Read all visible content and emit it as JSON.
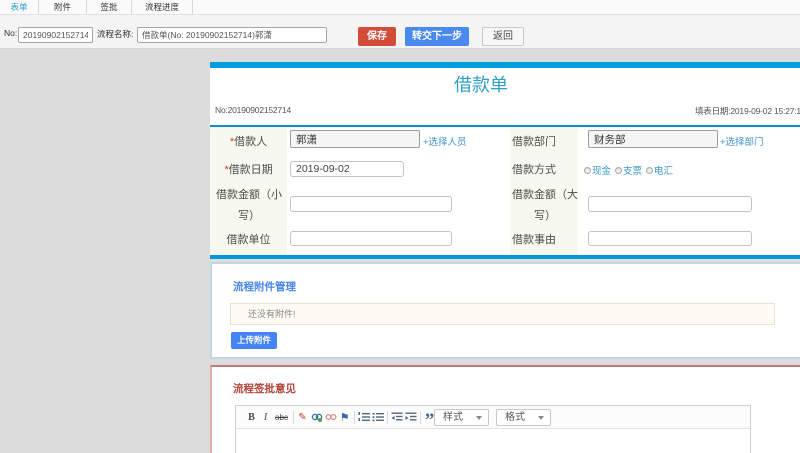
{
  "tabs": [
    {
      "label": "表单",
      "active": true
    },
    {
      "label": "附件",
      "active": false
    },
    {
      "label": "签批",
      "active": false
    },
    {
      "label": "流程进度",
      "active": false
    }
  ],
  "toolbar": {
    "no_label": "No:",
    "no_value": "20190902152714",
    "name_label": "流程名称:",
    "name_value": "借款单(No: 20190902152714)郭潇",
    "save_label": "保存",
    "next_label": "转交下一步",
    "back_label": "返回"
  },
  "form": {
    "title": "借款单",
    "no_text": "No:20190902152714",
    "date_text": "填表日期:2019-09-02 15:27:1",
    "required_mark": "*",
    "borrower_label": "借款人",
    "borrower_value": "郭潇",
    "borrower_link": "+选择人员",
    "dept_label": "借款部门",
    "dept_value": "财务部",
    "dept_link": "+选择部门",
    "date_label": "借款日期",
    "date_value": "2019-09-02",
    "method_label": "借款方式",
    "methods": [
      "现金",
      "支票",
      "电汇"
    ],
    "amount_small_label": "借款金额（小写）",
    "amount_big_label": "借款金额（大写）",
    "unit_label": "借款单位",
    "reason_label": "借款事由"
  },
  "attachments": {
    "heading": "流程附件管理",
    "empty_text": "还没有附件!",
    "upload_label": "上传附件"
  },
  "approval": {
    "heading": "流程签批意见",
    "style_dropdown": "样式",
    "format_dropdown": "格式",
    "editor_icons": [
      "bold",
      "italic",
      "strikethrough",
      "remove-format",
      "link",
      "unlink",
      "anchor",
      "ordered-list",
      "unordered-list",
      "outdent",
      "indent",
      "blockquote"
    ]
  }
}
